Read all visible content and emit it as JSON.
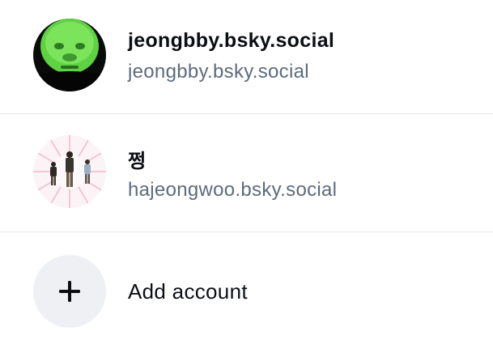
{
  "accounts": [
    {
      "display_name": "jeongbby.bsky.social",
      "handle": "jeongbby.bsky.social"
    },
    {
      "display_name": "쩡",
      "handle": "hajeongwoo.bsky.social"
    }
  ],
  "add_account": {
    "label": "Add account",
    "icon": "plus-icon"
  },
  "colors": {
    "handle_text": "#5c6b7d",
    "divider": "#e6e8eb",
    "add_circle_bg": "#eef0f3"
  }
}
